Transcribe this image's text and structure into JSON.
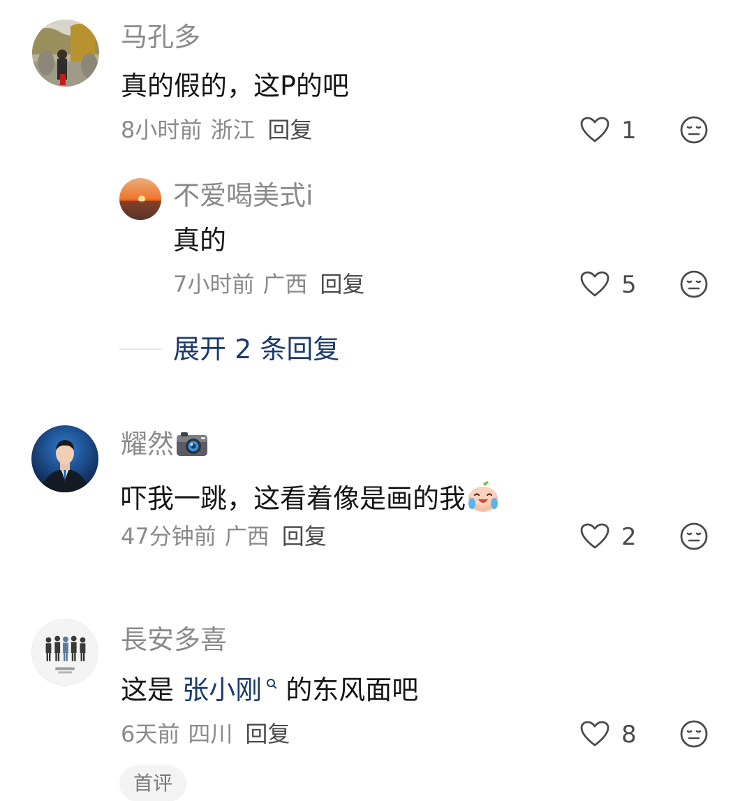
{
  "comments": [
    {
      "username": "马孔多",
      "text": "真的假的，这P的吧",
      "time": "8小时前",
      "location": "浙江",
      "reply_label": "回复",
      "likes": "1",
      "replies": [
        {
          "username": "不爱喝美式i",
          "text": "真的",
          "time": "7小时前",
          "location": "广西",
          "reply_label": "回复",
          "likes": "5"
        }
      ],
      "expand_label": "展开 2 条回复"
    },
    {
      "username": "耀然",
      "username_icon": "camera-emoji",
      "text": "吓我一跳，这看着像是画的我",
      "text_emoji": "crying-laughing-emoji",
      "time": "47分钟前",
      "location": "广西",
      "reply_label": "回复",
      "likes": "2"
    },
    {
      "username": "長安多喜",
      "text_before": "这是 ",
      "mention": "张小刚",
      "text_after": " 的东风面吧",
      "time": "6天前",
      "location": "四川",
      "reply_label": "回复",
      "likes": "8",
      "badge": "首评"
    }
  ],
  "colors": {
    "link": "#1b3a6b",
    "muted": "#8a8a8a",
    "text": "#161616"
  }
}
